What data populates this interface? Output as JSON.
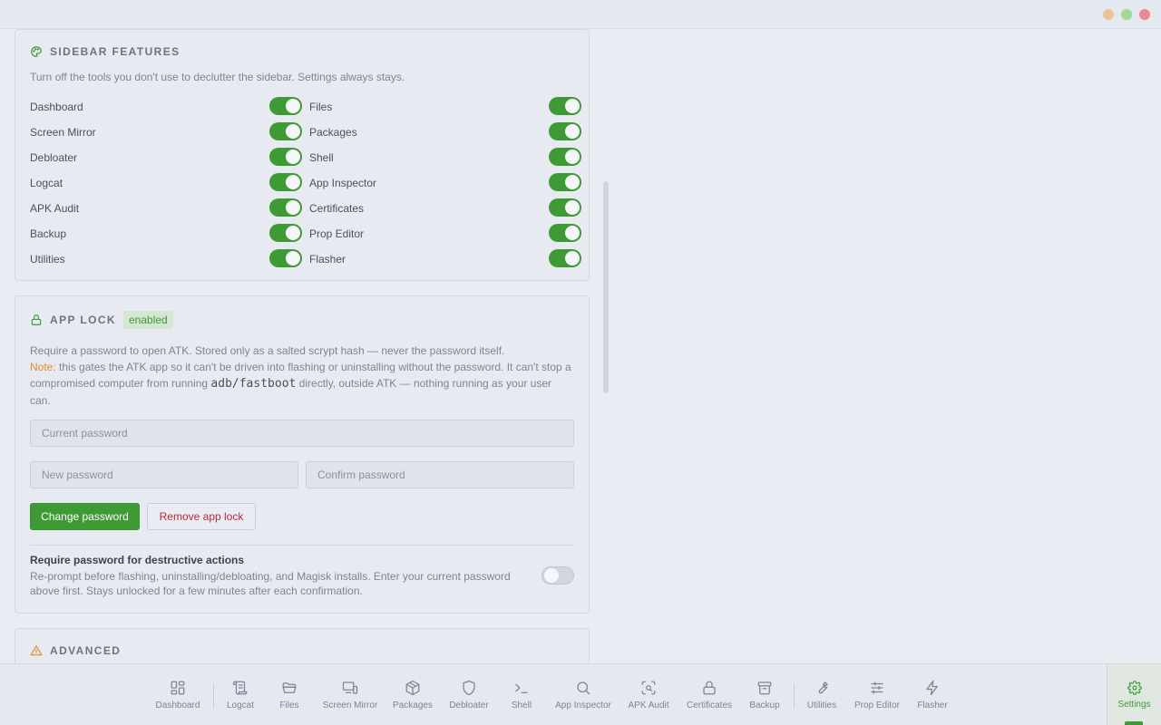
{
  "sidebar_features": {
    "title": "SIDEBAR FEATURES",
    "icon": "palette-icon",
    "description": "Turn off the tools you don't use to declutter the sidebar. Settings always stays.",
    "left": [
      {
        "label": "Dashboard",
        "enabled": true
      },
      {
        "label": "Screen Mirror",
        "enabled": true
      },
      {
        "label": "Debloater",
        "enabled": true
      },
      {
        "label": "Logcat",
        "enabled": true
      },
      {
        "label": "APK Audit",
        "enabled": true
      },
      {
        "label": "Backup",
        "enabled": true
      },
      {
        "label": "Utilities",
        "enabled": true
      }
    ],
    "right": [
      {
        "label": "Files",
        "enabled": true
      },
      {
        "label": "Packages",
        "enabled": true
      },
      {
        "label": "Shell",
        "enabled": true
      },
      {
        "label": "App Inspector",
        "enabled": true
      },
      {
        "label": "Certificates",
        "enabled": true
      },
      {
        "label": "Prop Editor",
        "enabled": true
      },
      {
        "label": "Flasher",
        "enabled": true
      }
    ]
  },
  "app_lock": {
    "title": "APP LOCK",
    "icon": "lock-icon",
    "badge": "enabled",
    "desc_line1": "Require a password to open ATK. Stored only as a salted scrypt hash — never the password itself.",
    "note_label": "Note:",
    "note_text_a": " this gates the ATK app so it can't be driven into flashing or uninstalling without the password. It can't stop a compromised computer from running ",
    "note_code": "adb/fastboot",
    "note_text_b": " directly, outside ATK — nothing running as your user can.",
    "current_placeholder": "Current password",
    "new_placeholder": "New password",
    "confirm_placeholder": "Confirm password",
    "change_button": "Change password",
    "remove_button": "Remove app lock",
    "destructive_title": "Require password for destructive actions",
    "destructive_desc": "Re-prompt before flashing, uninstalling/debloating, and Magisk installs. Enter your current password above first. Stays unlocked for a few minutes after each confirmation.",
    "destructive_enabled": false
  },
  "advanced": {
    "title": "ADVANCED",
    "icon": "warning-icon"
  },
  "bottom_nav": [
    {
      "label": "Dashboard",
      "icon": "dashboard-icon"
    },
    {
      "label": "Logcat",
      "icon": "scroll-icon"
    },
    {
      "label": "Files",
      "icon": "folder-icon"
    },
    {
      "label": "Screen Mirror",
      "icon": "screen-mirror-icon"
    },
    {
      "label": "Packages",
      "icon": "package-icon"
    },
    {
      "label": "Debloater",
      "icon": "shield-icon"
    },
    {
      "label": "Shell",
      "icon": "terminal-icon"
    },
    {
      "label": "App Inspector",
      "icon": "search-icon"
    },
    {
      "label": "APK Audit",
      "icon": "scan-icon"
    },
    {
      "label": "Certificates",
      "icon": "lock-icon"
    },
    {
      "label": "Backup",
      "icon": "archive-icon"
    },
    {
      "label": "Utilities",
      "icon": "wrench-icon"
    },
    {
      "label": "Prop Editor",
      "icon": "sliders-icon"
    },
    {
      "label": "Flasher",
      "icon": "bolt-icon"
    }
  ],
  "settings_nav": {
    "label": "Settings",
    "icon": "gear-icon",
    "active": true
  },
  "colors": {
    "accent": "#3e9a34",
    "danger": "#c0263d",
    "note": "#e08c2f"
  }
}
